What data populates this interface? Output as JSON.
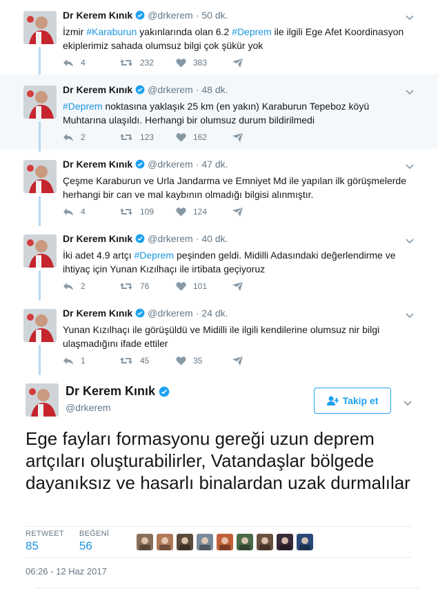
{
  "colors": {
    "accent": "#1da1f2",
    "hashtag": "#1b95e0",
    "muted": "#657786",
    "thread_line": "#b5d9f1",
    "highlight_bg": "#f5f8fa"
  },
  "author": {
    "name": "Dr Kerem Kınık",
    "handle": "@drkerem"
  },
  "thread": [
    {
      "time": "50 dk.",
      "segments": [
        {
          "text": "İzmir ",
          "tag": false
        },
        {
          "text": "#Karaburun",
          "tag": true
        },
        {
          "text": " yakınlarında olan 6.2 ",
          "tag": false
        },
        {
          "text": "#Deprem",
          "tag": true
        },
        {
          "text": " ile ilgili Ege Afet Koordinasyon ekiplerimiz sahada olumsuz bilgi çok şükür yok",
          "tag": false
        }
      ],
      "replies": "4",
      "retweets": "232",
      "likes": "383",
      "highlight": false
    },
    {
      "time": "48 dk.",
      "segments": [
        {
          "text": "#Deprem",
          "tag": true
        },
        {
          "text": " noktasına yaklaşık 25 km (en yakın) Karaburun Tepeboz köyü Muhtarına ulaşıldı. Herhangi bir olumsuz durum bildirilmedi",
          "tag": false
        }
      ],
      "replies": "2",
      "retweets": "123",
      "likes": "162",
      "highlight": true
    },
    {
      "time": "47 dk.",
      "segments": [
        {
          "text": "Çeşme Karaburun ve Urla Jandarma ve Emniyet Md ile yapılan ilk görüşmelerde herhangi bir can ve mal kaybının olmadığı bilgisi alınmıştır.",
          "tag": false
        }
      ],
      "replies": "4",
      "retweets": "109",
      "likes": "124",
      "highlight": false
    },
    {
      "time": "40 dk.",
      "segments": [
        {
          "text": "İki adet 4.9 artçı ",
          "tag": false
        },
        {
          "text": "#Deprem",
          "tag": true
        },
        {
          "text": " peşinden geldi. Midilli Adasındaki değerlendirme ve ihtiyaç için Yunan Kızılhaçı ile irtibata geçiyoruz",
          "tag": false
        }
      ],
      "replies": "2",
      "retweets": "76",
      "likes": "101",
      "highlight": false
    },
    {
      "time": "24 dk.",
      "segments": [
        {
          "text": "Yunan Kızılhaçı ile görüşüldü ve Midilli ile ilgili kendilerine olumsuz nir bilgi ulaşmadığını ifade ettiler",
          "tag": false
        }
      ],
      "replies": "1",
      "retweets": "45",
      "likes": "35",
      "highlight": false
    }
  ],
  "main_tweet": {
    "name": "Dr Kerem Kınık",
    "handle": "@drkerem",
    "follow_label": "Takip et",
    "text": "Ege fayları formasyonu gereği uzun deprem artçıları oluşturabilirler, Vatandaşlar bölgede dayanıksız ve hasarlı binalardan uzak durmalılar",
    "retweet_label": "RETWEET",
    "retweet_count": "85",
    "like_label": "BEĞENİ",
    "like_count": "56",
    "timestamp": "06:26 - 12 Haz 2017",
    "liker_count": 9,
    "liker_colors": [
      "#8a6f5a",
      "#b07a5a",
      "#5a4a3a",
      "#7a8a9a",
      "#c0603a",
      "#4a6a4a",
      "#6a5040",
      "#3a2a3a",
      "#2a4a7a"
    ]
  }
}
